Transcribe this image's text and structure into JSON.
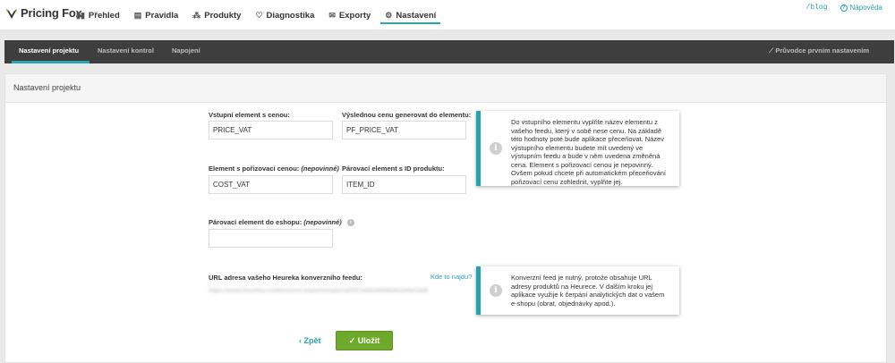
{
  "brand": {
    "name": "Pricing Fox",
    "accent": "#29a7b0"
  },
  "nav": {
    "items": [
      {
        "label": "Přehled",
        "icon": "chart-bars-icon",
        "glyph": "▮▮"
      },
      {
        "label": "Pravidla",
        "icon": "rules-icon",
        "glyph": "▤"
      },
      {
        "label": "Produkty",
        "icon": "products-icon",
        "glyph": "⁂"
      },
      {
        "label": "Diagnostika",
        "icon": "diagnostics-icon",
        "glyph": "♡"
      },
      {
        "label": "Exporty",
        "icon": "export-icon",
        "glyph": "✉"
      },
      {
        "label": "Nastavení",
        "icon": "gear-icon",
        "glyph": "⚙"
      }
    ],
    "active": "Nastavení"
  },
  "top_right": {
    "blog": "/blog",
    "help": "Nápověda",
    "help_glyph": "?"
  },
  "subnav": {
    "tabs": [
      {
        "label": "Nastavení projektu"
      },
      {
        "label": "Nastavení kontrol"
      },
      {
        "label": "Napojení"
      }
    ],
    "active": "Nastavení projektu",
    "wizard": "Průvodce prvním nastavením",
    "wizard_icon": "magic-wand-icon"
  },
  "panel": {
    "title": "Nastavení projektu"
  },
  "form": {
    "input_element_label": "Vstupní element s cenou:",
    "input_element_value": "PRICE_VAT",
    "output_element_label": "Výslednou cenu generovat do elementu:",
    "output_element_value": "PF_PRICE_VAT",
    "cost_element_label": "Element s pořizovací cenou:",
    "cost_element_optional": "(nepovinné)",
    "cost_element_value": "COST_VAT",
    "pairing_id_label": "Párovací element s ID produktu:",
    "pairing_id_value": "ITEM_ID",
    "eshop_pairing_label": "Párovací element do eshopu:",
    "eshop_pairing_optional": "(nepovinné)",
    "eshop_pairing_value": "",
    "eshop_pairing_info_glyph": "i",
    "heureka_label": "URL adresa vašeho Heureka konverzního feedu:",
    "heureka_help_link": "Kde to najdu?",
    "heureka_value": "https://www.heureka.cz/direct/xml-export/shops/ca/09f7a6b0d998b9d2e9e53d8"
  },
  "info_boxes": {
    "elements": "Do vstupního elementu vyplňte název elementu z vašeho feedu, který v sobě nese cenu. Na základě této hodnoty poté bude aplikace přeceňovat. Název výstupního elementu budete mít uvedený ve výstupním feedu a bude v něm uvedena změněná cena. Element s pořizovací cenou je nepovinný. Ovšem pokud chcete při automatickém přeceňování pořizovací cenu zohlednit, vyplňte jej.",
    "heureka": "Konverzní feed je nutný, protože obsahuje URL adresy produktů na Heurece. V dalším kroku jej aplikace využije k čerpání analytických dat o vašem e-shopu (obrat, objednávky apod.).",
    "glyph": "i"
  },
  "actions": {
    "back_label": "Zpět",
    "back_glyph": "‹",
    "save_label": "Uložit",
    "save_glyph": "✓",
    "save_color": "#6daa2c"
  }
}
